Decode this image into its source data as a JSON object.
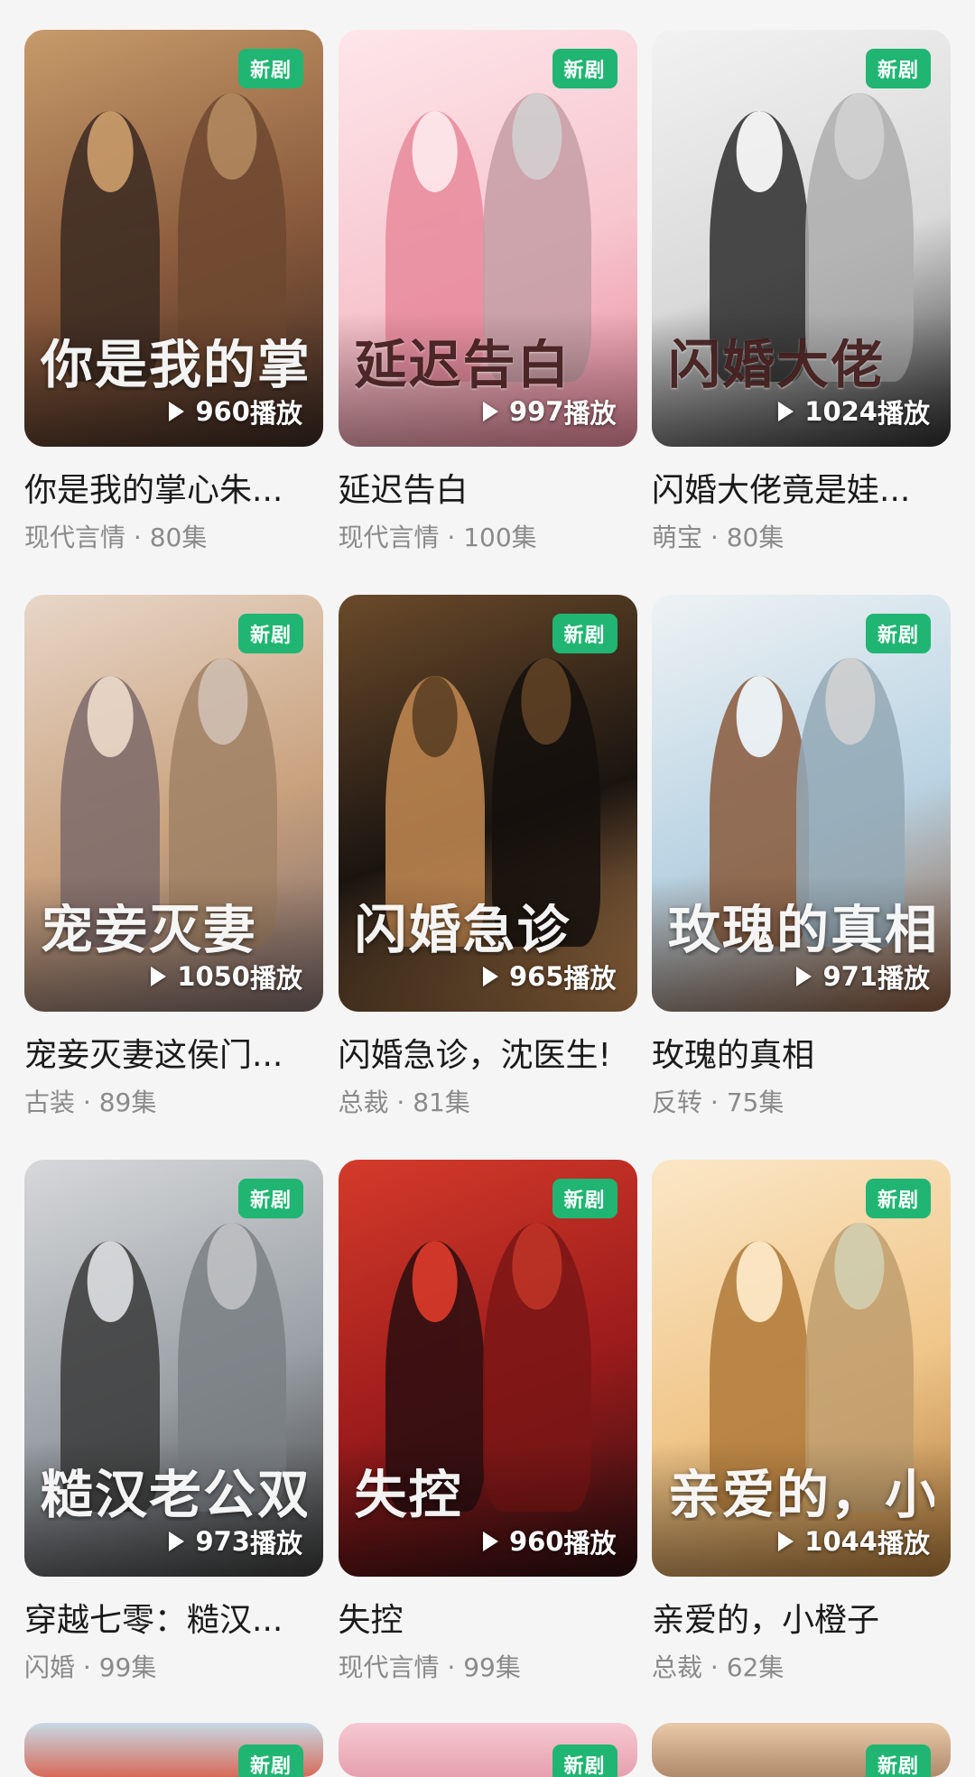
{
  "badge_label": "新剧",
  "plays_suffix": "播放",
  "dramas": [
    {
      "title": "你是我的掌心朱...",
      "genre": "现代言情",
      "episodes": "80集",
      "plays": "960",
      "poster_text": "你是我的掌心朱砂痣",
      "colors": [
        "#8a5a3c",
        "#c79a6a",
        "#3b2a22"
      ]
    },
    {
      "title": "延迟告白",
      "genre": "现代言情",
      "episodes": "100集",
      "plays": "997",
      "poster_text": "延迟告白",
      "colors": [
        "#f7c6cf",
        "#fde6ea",
        "#e88a9c"
      ]
    },
    {
      "title": "闪婚大佬竟是娃...",
      "genre": "萌宝",
      "episodes": "80集",
      "plays": "1024",
      "poster_text": "闪婚大佬",
      "colors": [
        "#d9d9d9",
        "#f2f2f2",
        "#2d2d2d"
      ]
    },
    {
      "title": "宠妾灭妻这侯门...",
      "genre": "古装",
      "episodes": "89集",
      "plays": "1050",
      "poster_text": "宠妾灭妻",
      "colors": [
        "#c9a27e",
        "#e8d6c8",
        "#7d6a6a"
      ]
    },
    {
      "title": "闪婚急诊，沈医生!",
      "genre": "总裁",
      "episodes": "81集",
      "plays": "965",
      "poster_text": "闪婚急诊",
      "colors": [
        "#1a1410",
        "#6b4a2a",
        "#c48a52"
      ]
    },
    {
      "title": "玫瑰的真相",
      "genre": "反转",
      "episodes": "75集",
      "plays": "971",
      "poster_text": "玫瑰的真相",
      "colors": [
        "#b9d3e3",
        "#eef2f4",
        "#8a5a3c"
      ]
    },
    {
      "title": "穿越七零：糙汉...",
      "genre": "闪婚",
      "episodes": "99集",
      "plays": "973",
      "poster_text": "糙汉老公双开门",
      "colors": [
        "#9aa0a6",
        "#d6d8da",
        "#3a3a3a"
      ]
    },
    {
      "title": "失控",
      "genre": "现代言情",
      "episodes": "99集",
      "plays": "960",
      "poster_text": "失控",
      "colors": [
        "#9b1b1b",
        "#d43a2a",
        "#2a0e10"
      ]
    },
    {
      "title": "亲爱的，小橙子",
      "genre": "总裁",
      "episodes": "62集",
      "plays": "1044",
      "poster_text": "亲爱的，小橙子",
      "colors": [
        "#f0c68a",
        "#fbe7c6",
        "#b07a3a"
      ]
    }
  ],
  "peek_colors": [
    [
      "#c7d9e6",
      "#d86a5a"
    ],
    [
      "#f6c9d2",
      "#e6a0ae"
    ],
    [
      "#e8c9a8",
      "#b08a6a"
    ]
  ]
}
